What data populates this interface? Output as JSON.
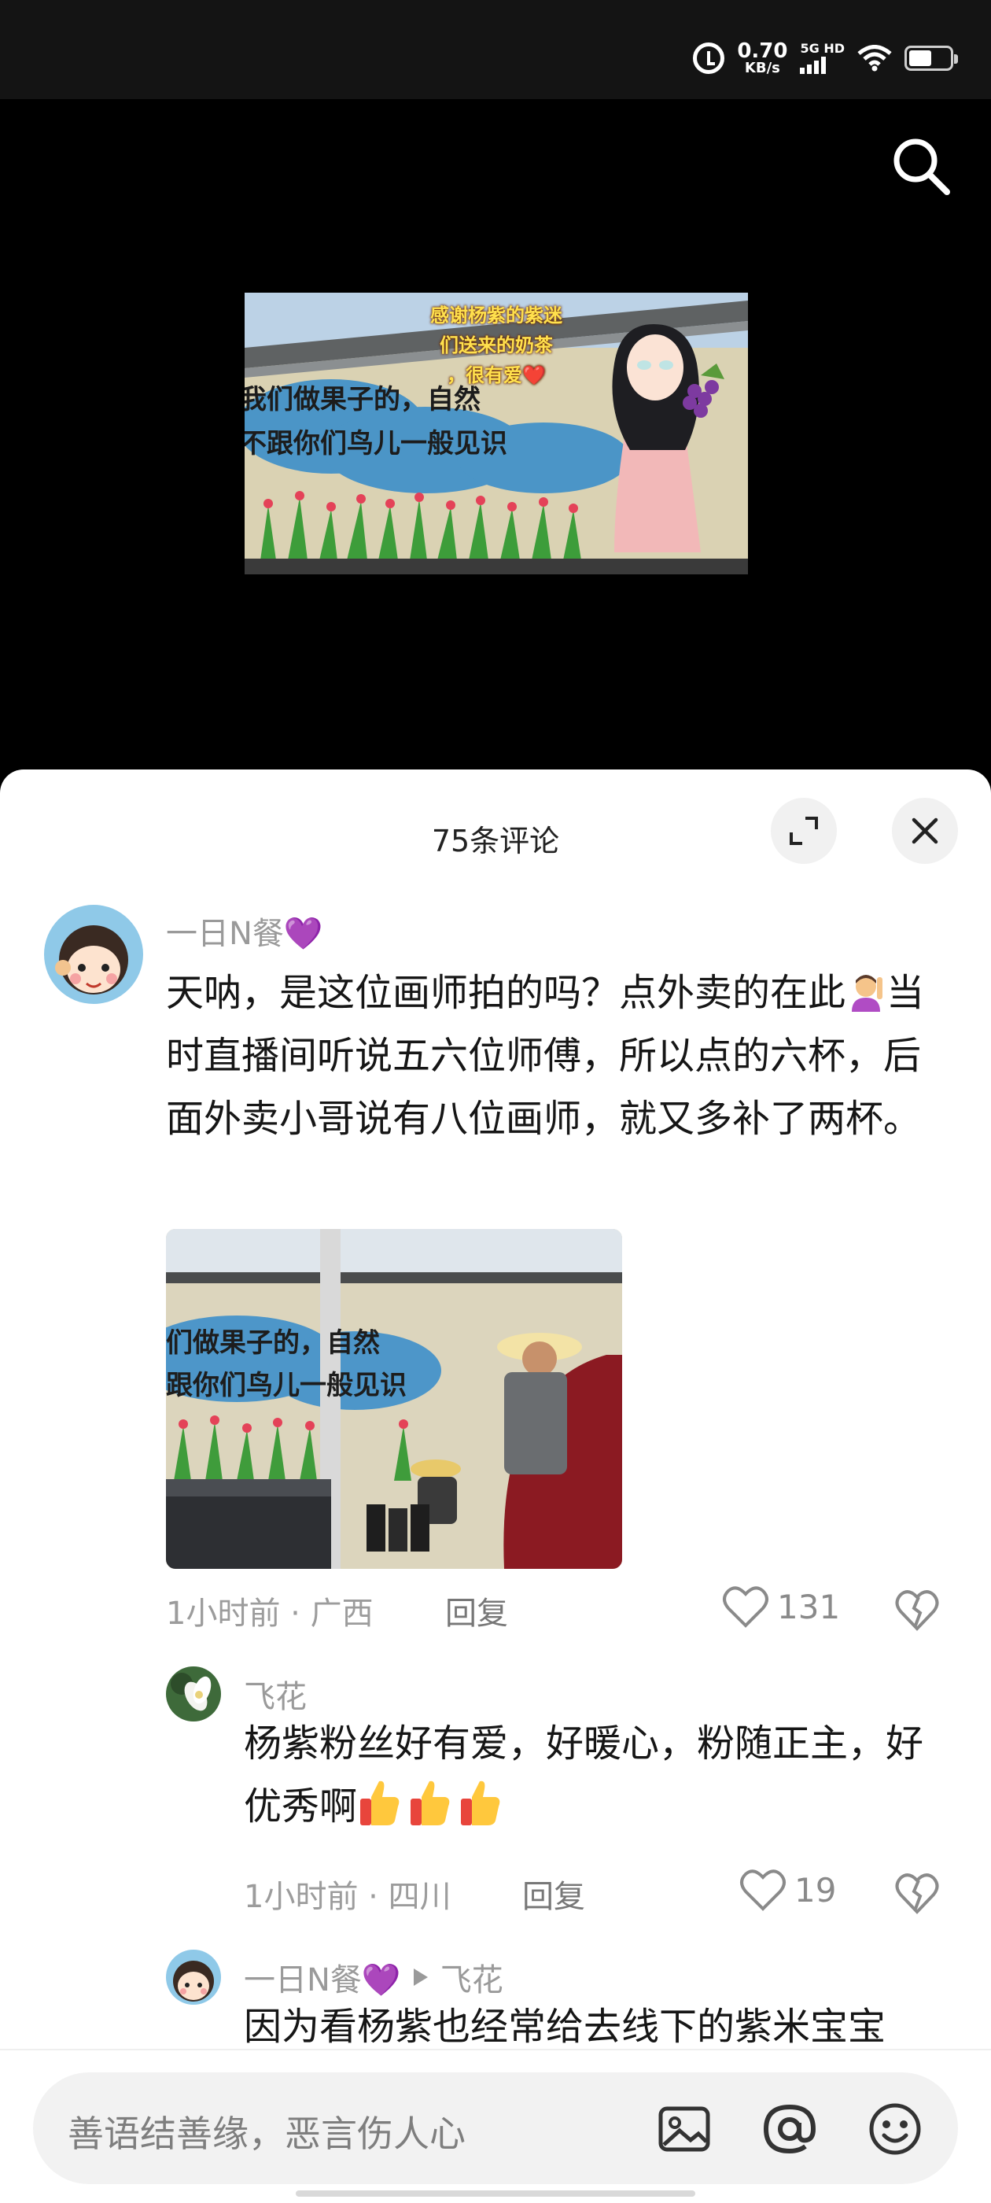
{
  "status_bar": {
    "speed_value": "0.70",
    "speed_unit": "KB/s",
    "network_label": "5G HD",
    "icons": [
      "alarm-icon",
      "signal-icon",
      "wifi-icon",
      "battery-icon"
    ],
    "battery_level": 0.55
  },
  "video": {
    "caption_lines": [
      "感谢杨紫的紫迷",
      "们送来的奶茶",
      "，很有爱❤️"
    ],
    "wall_text_lines": [
      "我们做果子的，自然",
      "不跟你们鸟儿一般见识"
    ]
  },
  "sheet": {
    "title": "75条评论",
    "icons": [
      "expand-icon",
      "close-icon"
    ]
  },
  "comments": [
    {
      "username": "一日N餐💜",
      "text_before_emoji": "天呐，是这位画师拍的吗？点外卖的在此",
      "text_after_emoji": "当时直播间听说五六位师傅，所以点的六杯，后面外卖小哥说有八位画师，就又多补了两杯。",
      "photo_wall_lines": [
        "们做果子的，自然",
        "跟你们鸟儿一般见识"
      ],
      "time_location": "1小时前 · 广西",
      "reply_label": "回复",
      "like_count": "131"
    },
    {
      "username": "飞花",
      "text": "杨紫粉丝好有爱，好暖心，粉随正主，好优秀啊",
      "time_location": "1小时前 · 四川",
      "reply_label": "回复",
      "like_count": "19"
    },
    {
      "username": "一日N餐💜",
      "reply_to": "飞花",
      "text": "因为看杨紫也经常给去线下的紫米宝宝"
    }
  ],
  "input": {
    "placeholder": "善语结善缘，恶言伤人心",
    "icons": [
      "image-icon",
      "at-icon",
      "emoji-icon"
    ]
  },
  "colors": {
    "sheet_bg": "#ffffff",
    "meta_gray": "#9c9c9c",
    "status_bar_bg": "#141414"
  }
}
